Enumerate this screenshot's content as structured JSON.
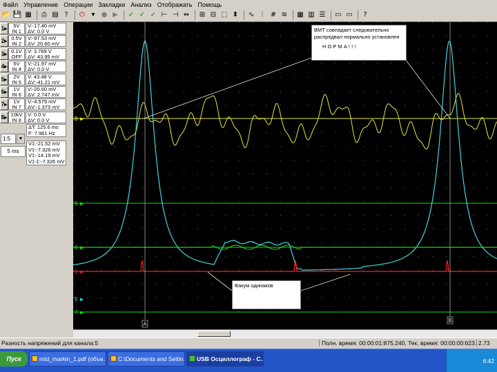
{
  "menu": [
    "Файл",
    "Управление",
    "Операции",
    "Закладки",
    "Анализ",
    "Отображать",
    "Помощь"
  ],
  "channels": [
    {
      "num": "1",
      "range": "5V",
      "input": "IN 1",
      "v": "V:-17.40 mV",
      "dv": "ΔV:  0.0 V"
    },
    {
      "num": "2",
      "range": "0.5V",
      "input": "IN 2",
      "v": "V:-97.53 mV",
      "dv": "ΔV: 20.60 mV"
    },
    {
      "num": "3",
      "range": "0.1V",
      "input": "OFF",
      "v": "V:  3.769 V",
      "dv": "ΔV: 43.95 mV"
    },
    {
      "num": "4",
      "range": "5V",
      "input": "IN 4",
      "v": "V:-21.97 mV",
      "dv": "ΔV:  0.0 V"
    },
    {
      "num": "5",
      "range": "2V",
      "input": "IN 5",
      "v": "V: 43.48 V",
      "dv": "ΔV:-41.21 mV"
    },
    {
      "num": "6",
      "range": "1V",
      "input": "IN 6",
      "v": "V:-20.60 mV",
      "dv": "ΔV: 2.747 mV"
    },
    {
      "num": "7",
      "range": "1V",
      "input": "IN 7",
      "v": "V:-4.579 mV",
      "dv": "ΔV:-1.373 mV"
    },
    {
      "num": "8",
      "range": "10kV",
      "input": "IN 8",
      "v": "V:  0.0 V",
      "dv": "ΔV:  0.0 V"
    }
  ],
  "scale": "1:5",
  "timebase": "5 ms",
  "time_meas": [
    "ΔT: 125.6 ms",
    "F:  7.961 Hz"
  ],
  "volt_meas": [
    "V‡:-21.52 mV",
    "V‡:-7.326 mV",
    "V‡:-14.19 mV",
    "V‡-‡:-7.326 mV"
  ],
  "notes": {
    "top": [
      "ВМТ совпадает следовательно",
      "распредвал нормально установлен",
      "",
      "Н О Р М А ! ! !"
    ],
    "bottom": "Вакум одинаков"
  },
  "markers": [
    {
      "label": "8",
      "color": "#ffff00"
    },
    {
      "label": "6",
      "color": "#00ff00"
    },
    {
      "label": "8",
      "color": "#00ff00"
    },
    {
      "label": "1",
      "color": "#ff2020"
    },
    {
      "label": "5",
      "color": "#00ffff"
    },
    {
      "label": "7",
      "color": "#00ff00"
    }
  ],
  "cursors": [
    "A",
    "B"
  ],
  "status": {
    "left": "Разность напряжений для канала:5",
    "right": "Полн. время: 00:00:01:875.240, Тек. время: 00:00:00:623.000",
    "extra": "2.73"
  },
  "taskbar": {
    "start": "Пуск",
    "tasks": [
      "mtd_markin_1.pdf (объе...",
      "C:\\Documents and Settin...",
      "USB Осциллограф - С..."
    ],
    "clock": "6:42"
  }
}
